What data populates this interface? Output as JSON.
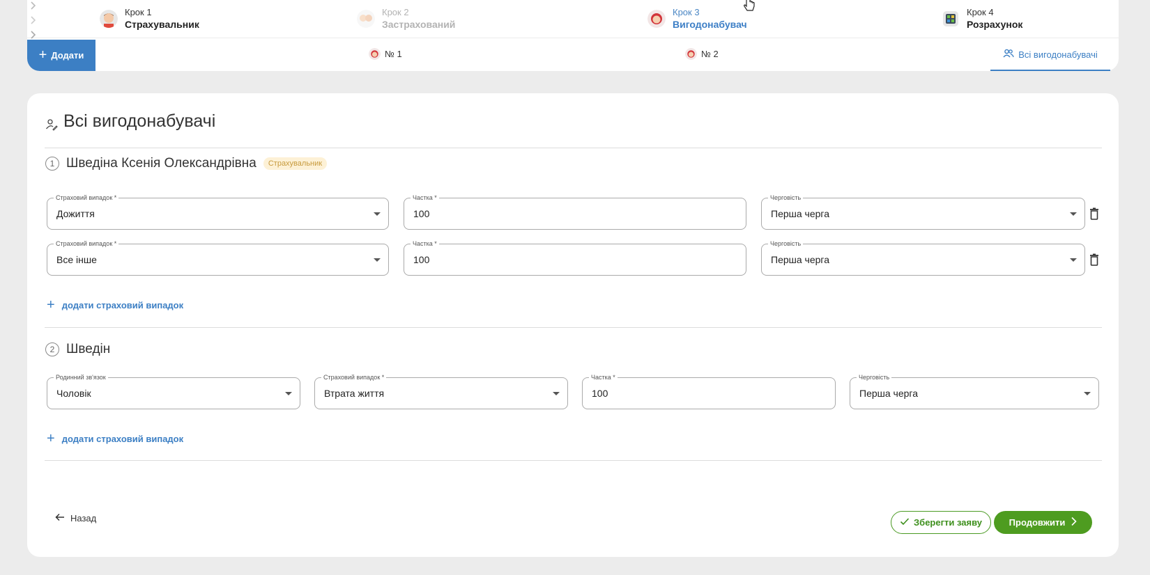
{
  "steps": [
    {
      "k": "Крок 1",
      "n": "Страхувальник",
      "state": "done",
      "icon": "person-avatar-icon"
    },
    {
      "k": "Крок 2",
      "n": "Застрахований",
      "state": "dim",
      "icon": "people-avatar-icon"
    },
    {
      "k": "Крок 3",
      "n": "Вигодонабувач",
      "state": "active",
      "icon": "woman-avatar-icon"
    },
    {
      "k": "Крок 4",
      "n": "Розрахунок",
      "state": "todo",
      "icon": "calculator-icon"
    }
  ],
  "tabs": {
    "add_label": "Додати",
    "items": [
      {
        "label": "№ 1"
      },
      {
        "label": "№ 2"
      }
    ],
    "all_label": "Всі вигодонабувачі"
  },
  "main": {
    "title": "Всі вигодонабувачі",
    "beneficiaries": [
      {
        "num": "1",
        "name": "Шведіна Ксенія Олександрівна",
        "badge": "Страхувальник",
        "rows": [
          {
            "case_label": "Страховий випадок *",
            "case": "Дожиття",
            "share_label": "Частка *",
            "share": "100",
            "order_label": "Черговість",
            "order": "Перша черга"
          },
          {
            "case_label": "Страховий випадок *",
            "case": "Все інше",
            "share_label": "Частка *",
            "share": "100",
            "order_label": "Черговість",
            "order": "Перша черга"
          }
        ],
        "add_case": "додати страховий випадок"
      },
      {
        "num": "2",
        "name": "Шведін",
        "rows": [
          {
            "relation_label": "Родинний зв'язок",
            "relation": "Чоловік",
            "case_label": "Страховий випадок *",
            "case": "Втрата життя",
            "share_label": "Частка *",
            "share": "100",
            "order_label": "Черговість",
            "order": "Перша черга"
          }
        ],
        "add_case": "додати страховий випадок"
      }
    ]
  },
  "footer": {
    "back_label": "Назад",
    "save_label": "Зберегти заяву",
    "continue_label": "Продовжити"
  },
  "colors": {
    "accent": "#3c7fc4",
    "success": "#4e9c20",
    "badge_bg": "#fdf1d6",
    "badge_text": "#c79a3c"
  }
}
